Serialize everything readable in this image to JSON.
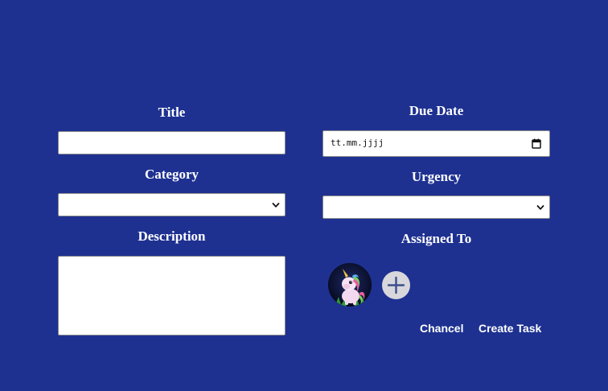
{
  "form": {
    "title_label": "Title",
    "title_value": "",
    "category_label": "Category",
    "category_value": "",
    "description_label": "Description",
    "description_value": "",
    "due_date_label": "Due Date",
    "due_date_placeholder": "tt.mm.jjjj",
    "urgency_label": "Urgency",
    "urgency_value": "",
    "assigned_label": "Assigned To"
  },
  "actions": {
    "cancel_label": "Chancel",
    "create_label": "Create Task"
  },
  "icons": {
    "due_date": "calendar-icon",
    "dropdown": "chevron-down-icon",
    "add_assignee": "plus-icon"
  },
  "colors": {
    "background": "#1e3191",
    "text": "#ffffff",
    "add_button": "#d7d7dc",
    "plus_icon": "#3c4f8c"
  }
}
